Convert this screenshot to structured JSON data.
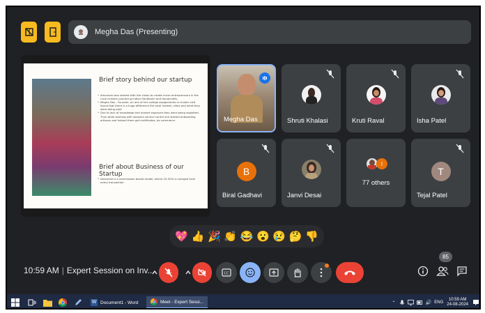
{
  "presenter_bar": {
    "name": "Megha Das (Presenting)"
  },
  "slide": {
    "title1": "Brief story behind our startup",
    "bullets1": [
      "Amounee was started with the vision to create micro entrepreneurs in the rural clusters practicing Indian Handloom and Handicrafts.",
      "Megha Das - Founder, on one of her college assignments in cluster visit found that there is a huge difference the local market, cities and what they were being paid",
      "Due to lack of knowledge and market exposure they were being exploited. Thus while working with weavers service centre she started onboarding artisans and helped them get certificates, do commerce."
    ],
    "title2": "Brief about Business of our Startup",
    "bullets2": [
      "Amounee is a commission based model, where 25-30% is charged from every transaction."
    ]
  },
  "participants": [
    {
      "name": "Megha Das",
      "speaking": true
    },
    {
      "name": "Shruti Khalasi",
      "muted": true
    },
    {
      "name": "Kruti Raval",
      "muted": true
    },
    {
      "name": "Isha Patel",
      "muted": true
    },
    {
      "name": "Biral Gadhavi",
      "muted": true,
      "letter": "B",
      "color": "#e8710a"
    },
    {
      "name": "Janvi Desai",
      "muted": true
    },
    {
      "name": "77 others",
      "badge_letter": "I"
    },
    {
      "name": "Tejal Patel",
      "muted": true,
      "letter": "T",
      "color": "#a1887f"
    }
  ],
  "reactions": [
    "💖",
    "👍",
    "🎉",
    "👏",
    "😂",
    "😮",
    "😢",
    "🤔",
    "👎"
  ],
  "bottom_bar": {
    "time": "10:59 AM",
    "meeting_title": "Expert Session on Inv...",
    "participant_count": "85"
  },
  "taskbar": {
    "apps": [
      {
        "label": "Document1 - Word"
      },
      {
        "label": "Meet - Expert Sessi..."
      }
    ],
    "lang": "ENG",
    "clock_time": "10:59 AM",
    "clock_date": "24-08-2024"
  },
  "colors": {
    "accent_yellow": "#f9ba1f",
    "end_call_red": "#ea4335",
    "active_blue": "#8ab4f8",
    "tile_bg": "#3c4043"
  }
}
